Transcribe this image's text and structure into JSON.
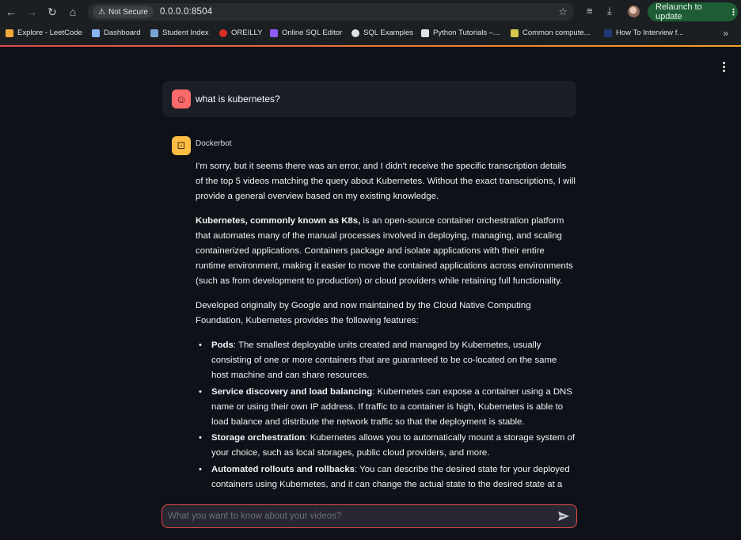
{
  "browser": {
    "security_label": "Not Secure",
    "url": "0.0.0.0:8504",
    "relaunch_label": "Relaunch to update",
    "bookmarks": [
      {
        "label": "Explore - LeetCode",
        "color": "#f2a93b"
      },
      {
        "label": "Dashboard",
        "color": "#8ab4f8"
      },
      {
        "label": "Student Index",
        "color": "#7aa2d6"
      },
      {
        "label": "OREILLY",
        "color": "#d93025"
      },
      {
        "label": "Online SQL Editor",
        "color": "#8b5cf6"
      },
      {
        "label": "SQL Examples",
        "color": "#dfe1e4"
      },
      {
        "label": "Python Tutorials –...",
        "color": "#dfe1e4"
      },
      {
        "label": "Common compute...",
        "color": "#d5c84a"
      },
      {
        "label": "How To Interview f...",
        "color": "#1f3b73"
      }
    ]
  },
  "chat": {
    "user_message": "what is kubernetes?",
    "bot_name": "Dockerbot",
    "paragraphs": {
      "p1": "I'm sorry, but it seems there was an error, and I didn't receive the specific transcription details of the top 5 videos matching the query about Kubernetes. Without the exact transcriptions, I will provide a general overview based on my existing knowledge.",
      "p2_bold": "Kubernetes, commonly known as K8s,",
      "p2_rest": " is an open-source container orchestration platform that automates many of the manual processes involved in deploying, managing, and scaling containerized applications. Containers package and isolate applications with their entire runtime environment, making it easier to move the contained applications across environments (such as from development to production) or cloud providers while retaining full functionality.",
      "p3": "Developed originally by Google and now maintained by the Cloud Native Computing Foundation, Kubernetes provides the following features:"
    },
    "features": [
      {
        "title": "Pods",
        "text": ": The smallest deployable units created and managed by Kubernetes, usually consisting of one or more containers that are guaranteed to be co-located on the same host machine and can share resources."
      },
      {
        "title": "Service discovery and load balancing",
        "text": ": Kubernetes can expose a container using a DNS name or using their own IP address. If traffic to a container is high, Kubernetes is able to load balance and distribute the network traffic so that the deployment is stable."
      },
      {
        "title": "Storage orchestration",
        "text": ": Kubernetes allows you to automatically mount a storage system of your choice, such as local storages, public cloud providers, and more."
      },
      {
        "title": "Automated rollouts and rollbacks",
        "text": ": You can describe the desired state for your deployed containers using Kubernetes, and it can change the actual state to the desired state at a"
      }
    ],
    "input_placeholder": "What you want to know about your videos?"
  },
  "colors": {
    "accent": "#e5484d",
    "user_avatar": "#ff6b6b",
    "bot_avatar": "#ffbd45",
    "background": "#0e1117"
  }
}
